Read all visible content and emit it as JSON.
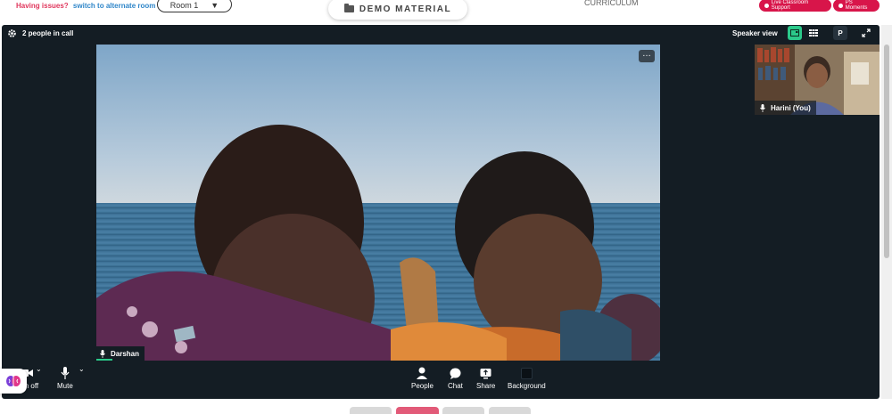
{
  "topbar": {
    "issues_question": "Having issues?",
    "issues_link": "switch to alternate room",
    "room_label": "Room 1",
    "demo_label": "DEMO MATERIAL",
    "curriculum_label": "CURRICULUM",
    "support_label": "Live Classroom Support",
    "moments_label": "PS Moments"
  },
  "call": {
    "people_count": "2 people in call",
    "speaker_view_label": "Speaker view",
    "p_label": "P",
    "main_participant": "Darshan",
    "self_participant": "Harini (You)"
  },
  "controls": {
    "video_label": "Turn off",
    "mute_label": "Mute",
    "people_label": "People",
    "chat_label": "Chat",
    "share_label": "Share",
    "background_label": "Background"
  },
  "colors": {
    "call_bg": "#141d24",
    "accent_green": "#2bc98a",
    "pill_red": "#d8154a",
    "issues_red": "#e0365c",
    "link_blue": "#2f86c9"
  }
}
